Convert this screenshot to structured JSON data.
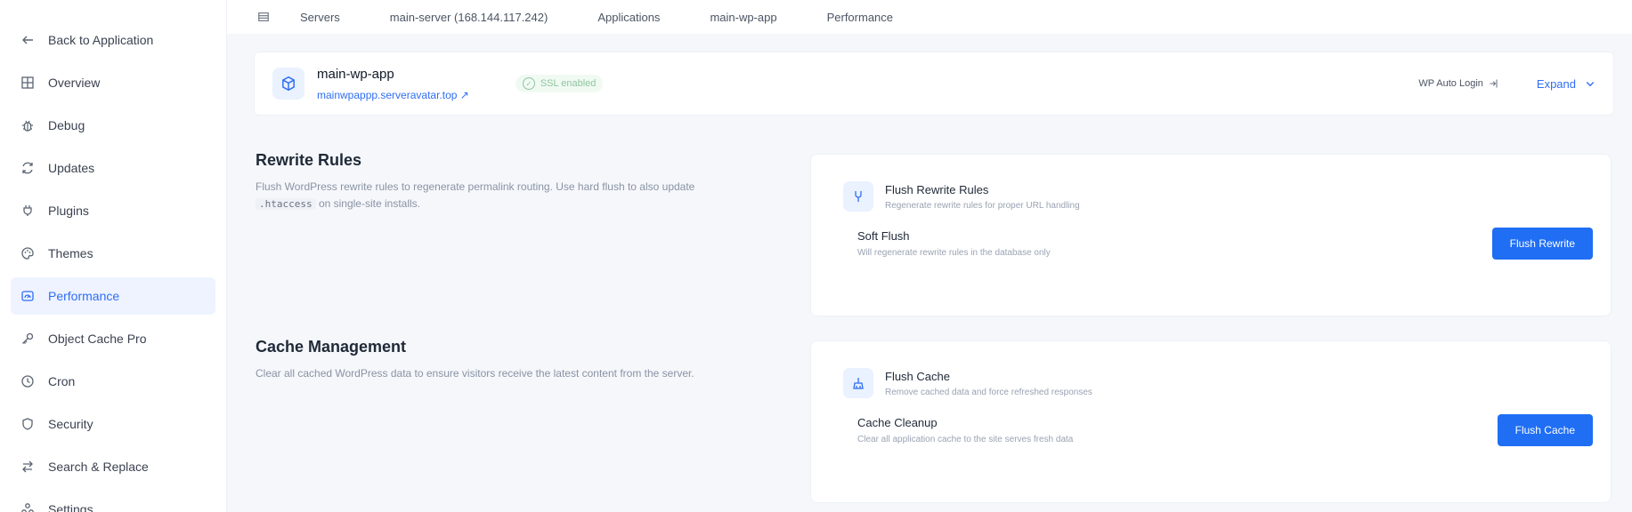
{
  "sidebar": {
    "back": "Back to Application",
    "items": [
      {
        "label": "Overview",
        "icon": "grid-icon"
      },
      {
        "label": "Debug",
        "icon": "bug-icon"
      },
      {
        "label": "Updates",
        "icon": "refresh-icon"
      },
      {
        "label": "Plugins",
        "icon": "plugin-icon"
      },
      {
        "label": "Themes",
        "icon": "palette-icon"
      },
      {
        "label": "Performance",
        "icon": "gauge-icon",
        "active": true
      },
      {
        "label": "Object Cache Pro",
        "icon": "key-icon"
      },
      {
        "label": "Cron",
        "icon": "clock-icon"
      },
      {
        "label": "Security",
        "icon": "shield-icon"
      },
      {
        "label": "Search & Replace",
        "icon": "swap-icon"
      },
      {
        "label": "Settings",
        "icon": "settings-icon"
      }
    ]
  },
  "breadcrumb": {
    "items": [
      "Servers",
      "main-server (168.144.117.242)",
      "Applications",
      "main-wp-app",
      "Performance"
    ]
  },
  "app": {
    "name": "main-wp-app",
    "url": "mainwpappp.serveravatar.top ↗",
    "ssl_label": "SSL enabled",
    "autologin_label": "WP Auto Login",
    "expand_label": "Expand"
  },
  "rewrite": {
    "title": "Rewrite Rules",
    "desc_before": "Flush WordPress rewrite rules to regenerate permalink routing. Use hard flush to also update ",
    "desc_code": ".htaccess",
    "desc_after": " on single-site installs.",
    "card_title": "Flush Rewrite Rules",
    "card_sub": "Regenerate rewrite rules for proper URL handling",
    "row_title": "Soft Flush",
    "row_sub": "Will regenerate rewrite rules in the database only",
    "button": "Flush Rewrite"
  },
  "cache": {
    "title": "Cache Management",
    "desc": "Clear all cached WordPress data to ensure visitors receive the latest content from the server.",
    "card_title": "Flush Cache",
    "card_sub": "Remove cached data and force refreshed responses",
    "row_title": "Cache Cleanup",
    "row_sub": "Clear all application cache to the site serves fresh data",
    "button": "Flush Cache"
  },
  "colors": {
    "accent": "#1f6ef4",
    "active_bg": "#eef3ff",
    "ssl_green": "#8fc5a0"
  }
}
